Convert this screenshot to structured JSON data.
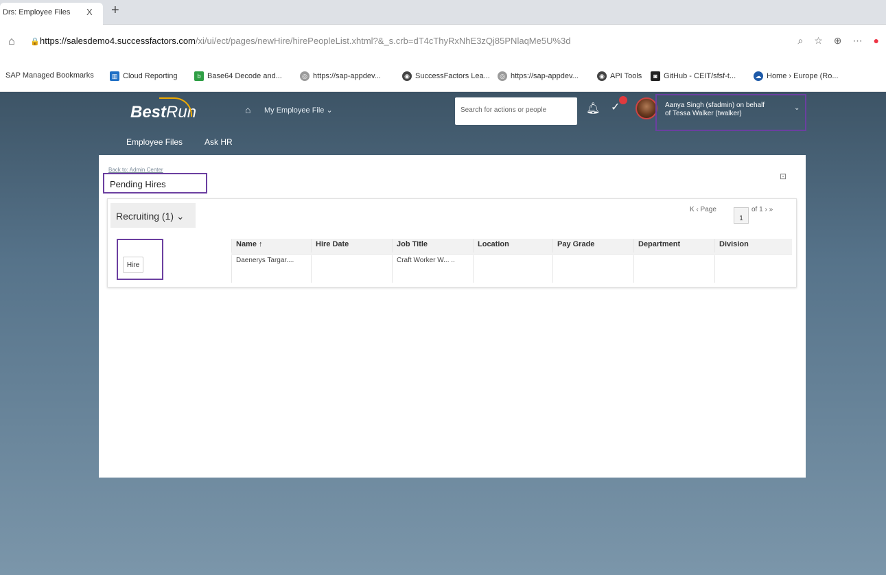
{
  "browser": {
    "tab_title": "Drs: Employee Files",
    "tab_close": "X",
    "new_tab": "+",
    "url_host": "https://salesdemo4.successfactors.com",
    "url_path": "/xi/ui/ect/pages/newHire/hirePeopleList.xhtml?&_s.crb=dT4cThyRxNhE3zQj85PNlaqMe5U%3d",
    "bookmarks": [
      "SAP Managed Bookmarks",
      "Cloud Reporting",
      "Base64 Decode and...",
      "https://sap-appdev...",
      "SuccessFactors Lea...",
      "https://sap-appdev...",
      "API Tools",
      "GitHub - CEIT/sfsf-t...",
      "Home › Europe (Ro..."
    ]
  },
  "header": {
    "logo_best": "Best",
    "logo_run": "Run",
    "module": "My Employee File ⌄",
    "search_placeholder": "Search for actions or people",
    "user_line1": "Aanya Singh (sfadmin) on behalf",
    "user_line2": "of Tessa Walker (twalker)",
    "nav_items": [
      "Employee Files",
      "Ask HR"
    ]
  },
  "card": {
    "back_link": "Back to: Admin Center",
    "title": "Pending Hires",
    "tab_label": "Recruiting (1) ⌄",
    "pager_prefix": "K ‹  Page",
    "pager_value": "1",
    "pager_suffix": "of 1 › »",
    "hire_button": "Hire",
    "columns": [
      "Name ↑",
      "Hire Date",
      "Job Title",
      "Location",
      "Pay Grade",
      "Department",
      "Division"
    ],
    "row": [
      "Daenerys Targar....",
      "",
      "Craft Worker W... ..",
      "",
      "",
      "",
      ""
    ]
  }
}
